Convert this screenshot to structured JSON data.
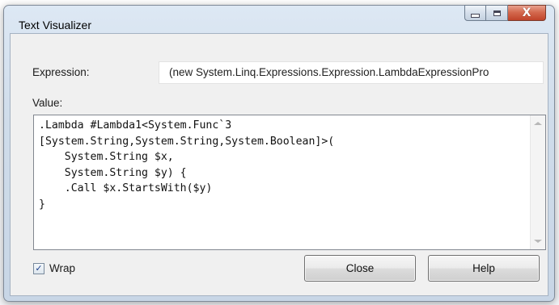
{
  "window": {
    "title": "Text Visualizer",
    "controls": {
      "minimize": "minimize-icon",
      "maximize": "maximize-icon",
      "close_glyph": "X"
    }
  },
  "expression": {
    "label": "Expression:",
    "value": "(new System.Linq.Expressions.Expression.LambdaExpressionPro"
  },
  "value": {
    "label": "Value:",
    "text": ".Lambda #Lambda1<System.Func`3\n[System.String,System.String,System.Boolean]>(\n    System.String $x,\n    System.String $y) {\n    .Call $x.StartsWith($y)\n}"
  },
  "wrap": {
    "label": "Wrap",
    "checked": true,
    "check_glyph": "✓"
  },
  "buttons": {
    "close": "Close",
    "help": "Help"
  }
}
